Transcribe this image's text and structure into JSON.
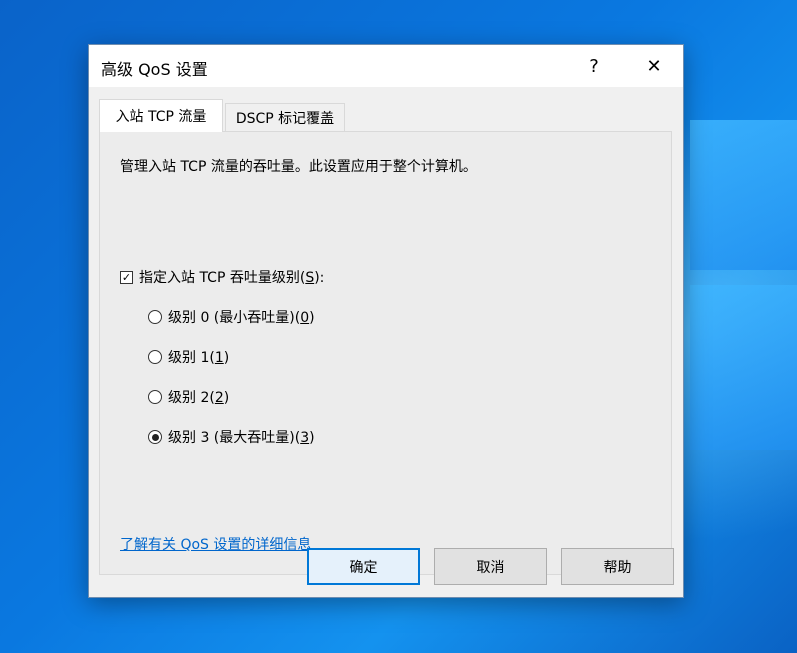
{
  "dialog": {
    "title": "高级 QoS 设置",
    "help_glyph": "?",
    "close_glyph": "✕"
  },
  "tabs": [
    {
      "label": "入站 TCP 流量",
      "selected": true
    },
    {
      "label": "DSCP 标记覆盖",
      "selected": false
    }
  ],
  "panel": {
    "description": "管理入站 TCP 流量的吞吐量。此设置应用于整个计算机。",
    "checkbox": {
      "label": "指定入站 TCP 吞吐量级别(",
      "hotkey": "S",
      "suffix": "):",
      "checked": true
    },
    "radios": [
      {
        "label": "级别 0 (最小吞吐量)(",
        "hotkey": "0",
        "suffix": ")",
        "selected": false
      },
      {
        "label": "级别 1(",
        "hotkey": "1",
        "suffix": ")",
        "selected": false
      },
      {
        "label": "级别 2(",
        "hotkey": "2",
        "suffix": ")",
        "selected": false
      },
      {
        "label": "级别 3 (最大吞吐量)(",
        "hotkey": "3",
        "suffix": ")",
        "selected": true
      }
    ],
    "link": "了解有关 QoS 设置的详细信息"
  },
  "buttons": {
    "ok": "确定",
    "cancel": "取消",
    "help": "帮助"
  },
  "icons": {
    "checkmark": "✓"
  },
  "colors": {
    "accent": "#0078d7",
    "link": "#0066cc",
    "desktop": "#0a78e0"
  }
}
